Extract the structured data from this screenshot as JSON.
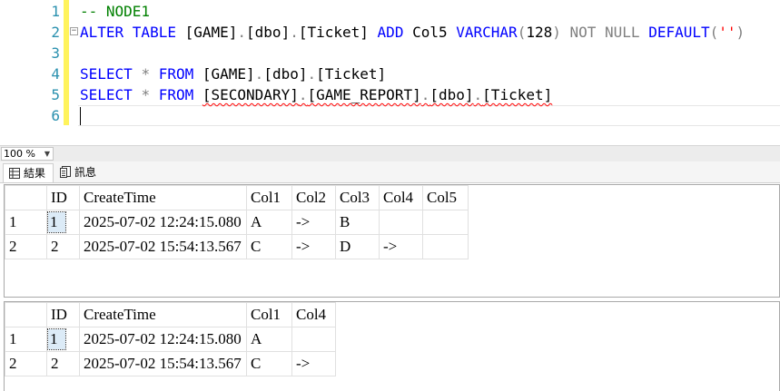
{
  "editor": {
    "line_numbers": [
      "1",
      "2",
      "3",
      "4",
      "5",
      "6"
    ],
    "lines": [
      {
        "parts": [
          {
            "t": "-- NODE1",
            "c": "cm"
          }
        ]
      },
      {
        "parts": [
          {
            "t": "ALTER TABLE ",
            "c": "kw"
          },
          {
            "t": "[GAME]",
            "c": ""
          },
          {
            "t": ".",
            "c": "gray"
          },
          {
            "t": "[dbo]",
            "c": ""
          },
          {
            "t": ".",
            "c": "gray"
          },
          {
            "t": "[Ticket] ",
            "c": ""
          },
          {
            "t": "ADD ",
            "c": "kw"
          },
          {
            "t": "Col5 ",
            "c": ""
          },
          {
            "t": "VARCHAR",
            "c": "kw"
          },
          {
            "t": "(",
            "c": "gray"
          },
          {
            "t": "128",
            "c": ""
          },
          {
            "t": ") ",
            "c": "gray"
          },
          {
            "t": "NOT NULL ",
            "c": "gray"
          },
          {
            "t": "DEFAULT",
            "c": "kw"
          },
          {
            "t": "(",
            "c": "gray"
          },
          {
            "t": "''",
            "c": "str"
          },
          {
            "t": ")",
            "c": "gray"
          }
        ]
      },
      {
        "parts": []
      },
      {
        "parts": [
          {
            "t": "SELECT ",
            "c": "kw"
          },
          {
            "t": "* ",
            "c": "gray"
          },
          {
            "t": "FROM ",
            "c": "kw"
          },
          {
            "t": "[GAME]",
            "c": ""
          },
          {
            "t": ".",
            "c": "gray"
          },
          {
            "t": "[dbo]",
            "c": ""
          },
          {
            "t": ".",
            "c": "gray"
          },
          {
            "t": "[Ticket]",
            "c": ""
          }
        ]
      },
      {
        "parts": [
          {
            "t": "SELECT ",
            "c": "kw"
          },
          {
            "t": "* ",
            "c": "gray"
          },
          {
            "t": "FROM ",
            "c": "kw"
          },
          {
            "t": "[SECONDARY]",
            "c": "squig"
          },
          {
            "t": ".",
            "c": "gray squig"
          },
          {
            "t": "[GAME_REPORT]",
            "c": "squig"
          },
          {
            "t": ".",
            "c": "gray squig"
          },
          {
            "t": "[dbo]",
            "c": "squig"
          },
          {
            "t": ".",
            "c": "gray squig"
          },
          {
            "t": "[Ticket]",
            "c": "squig"
          }
        ]
      },
      {
        "parts": []
      }
    ]
  },
  "zoom": {
    "value": "100 %"
  },
  "tabs": {
    "results": "結果",
    "messages": "訊息"
  },
  "grid1": {
    "columns": [
      "",
      "ID",
      "CreateTime",
      "Col1",
      "Col2",
      "Col3",
      "Col4",
      "Col5"
    ],
    "rows": [
      [
        "1",
        "1",
        "2025-07-02 12:24:15.080",
        "A",
        "->",
        "B",
        "",
        ""
      ],
      [
        "2",
        "2",
        "2025-07-02 15:54:13.567",
        "C",
        "->",
        "D",
        "->",
        ""
      ]
    ]
  },
  "grid2": {
    "columns": [
      "",
      "ID",
      "CreateTime",
      "Col1",
      "Col4"
    ],
    "rows": [
      [
        "1",
        "1",
        "2025-07-02 12:24:15.080",
        "A",
        ""
      ],
      [
        "2",
        "2",
        "2025-07-02 15:54:13.567",
        "C",
        "->"
      ]
    ]
  }
}
